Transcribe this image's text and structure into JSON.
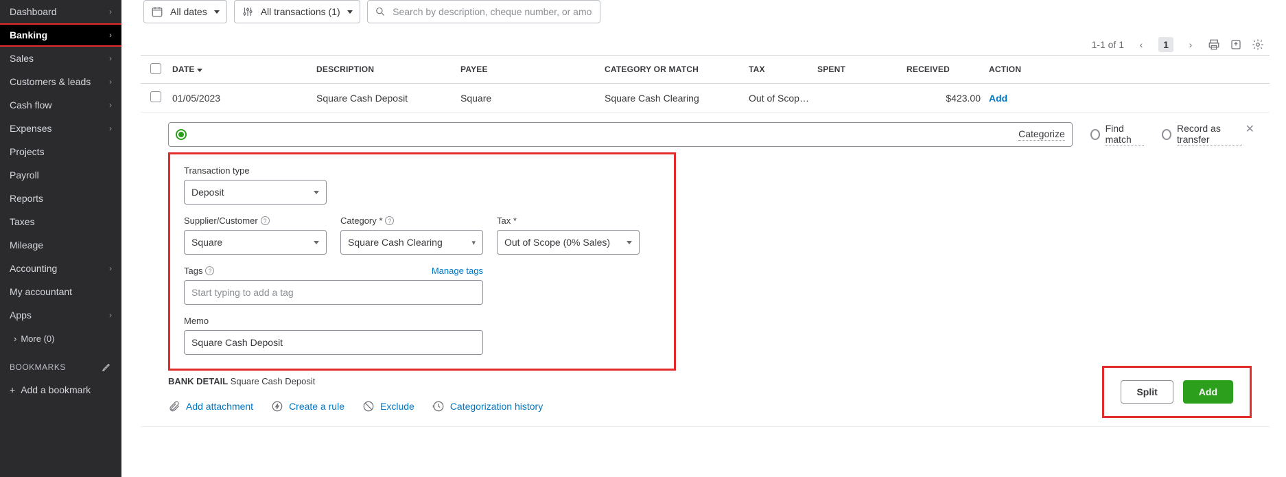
{
  "sidebar": {
    "items": [
      {
        "label": "Dashboard",
        "chev": true
      },
      {
        "label": "Banking",
        "chev": true,
        "active": true
      },
      {
        "label": "Sales",
        "chev": true
      },
      {
        "label": "Customers & leads",
        "chev": true
      },
      {
        "label": "Cash flow",
        "chev": true
      },
      {
        "label": "Expenses",
        "chev": true
      },
      {
        "label": "Projects",
        "chev": false
      },
      {
        "label": "Payroll",
        "chev": false
      },
      {
        "label": "Reports",
        "chev": false
      },
      {
        "label": "Taxes",
        "chev": false
      },
      {
        "label": "Mileage",
        "chev": false
      },
      {
        "label": "Accounting",
        "chev": true
      },
      {
        "label": "My accountant",
        "chev": false
      },
      {
        "label": "Apps",
        "chev": true
      }
    ],
    "more": "More (0)",
    "bookmarks_header": "BOOKMARKS",
    "add_bookmark": "Add a bookmark"
  },
  "filters": {
    "dates": "All dates",
    "transactions": "All transactions (1)",
    "search_placeholder": "Search by description, cheque number, or amo…"
  },
  "pager": {
    "range": "1-1 of 1",
    "current": "1"
  },
  "columns": {
    "date": "DATE",
    "desc": "DESCRIPTION",
    "payee": "PAYEE",
    "cat": "CATEGORY OR MATCH",
    "tax": "TAX",
    "spent": "SPENT",
    "received": "RECEIVED",
    "action": "ACTION"
  },
  "row": {
    "date": "01/05/2023",
    "desc": "Square Cash Deposit",
    "payee": "Square",
    "cat": "Square Cash Clearing",
    "tax": "Out of Scope (0%",
    "spent": "",
    "received": "$423.00",
    "action": "Add"
  },
  "radios": {
    "categorize": "Categorize",
    "find": "Find match",
    "transfer": "Record as transfer"
  },
  "form": {
    "trans_type_label": "Transaction type",
    "trans_type": "Deposit",
    "supplier_label": "Supplier/Customer",
    "supplier": "Square",
    "category_label": "Category *",
    "category": "Square Cash Clearing",
    "tax_label": "Tax *",
    "tax": "Out of Scope (0% Sales)",
    "tags_label": "Tags",
    "tags_placeholder": "Start typing to add a tag",
    "manage_tags": "Manage tags",
    "memo_label": "Memo",
    "memo": "Square Cash Deposit"
  },
  "bank_detail": {
    "label": "BANK DETAIL",
    "value": "Square Cash Deposit"
  },
  "actions": {
    "attach": "Add attachment",
    "rule": "Create a rule",
    "exclude": "Exclude",
    "history": "Categorization history"
  },
  "buttons": {
    "split": "Split",
    "add": "Add"
  }
}
